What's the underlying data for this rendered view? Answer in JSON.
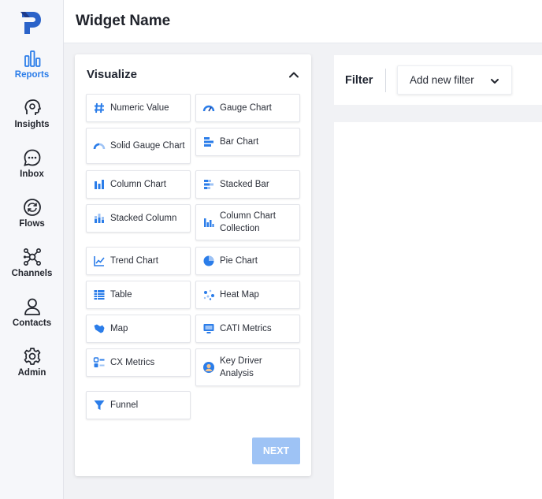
{
  "colors": {
    "accent": "#2b7de9",
    "next_disabled": "#9ec3f5",
    "icon_blue": "#2b7de9"
  },
  "sidebar": {
    "logo": "P",
    "items": [
      {
        "label": "Reports",
        "icon": "bar-chart-icon",
        "active": true
      },
      {
        "label": "Insights",
        "icon": "brain-icon",
        "active": false
      },
      {
        "label": "Inbox",
        "icon": "chat-bubble-icon",
        "active": false
      },
      {
        "label": "Flows",
        "icon": "flow-cycle-icon",
        "active": false
      },
      {
        "label": "Channels",
        "icon": "network-icon",
        "active": false
      },
      {
        "label": "Contacts",
        "icon": "person-icon",
        "active": false
      },
      {
        "label": "Admin",
        "icon": "gear-icon",
        "active": false
      }
    ]
  },
  "header": {
    "title": "Widget Name"
  },
  "visualize": {
    "title": "Visualize",
    "tiles": [
      {
        "label": "Numeric Value",
        "icon": "hash-icon"
      },
      {
        "label": "Gauge Chart",
        "icon": "gauge-icon"
      },
      {
        "label": "Solid Gauge Chart",
        "icon": "solid-gauge-icon"
      },
      {
        "label": "Bar Chart",
        "icon": "bar-chart-horizontal-icon"
      },
      {
        "label": "Column Chart",
        "icon": "column-chart-icon"
      },
      {
        "label": "Stacked Bar",
        "icon": "stacked-bar-icon"
      },
      {
        "label": "Stacked Column",
        "icon": "stacked-column-icon"
      },
      {
        "label": "Column Chart Collection",
        "icon": "column-collection-icon"
      },
      {
        "label": "Trend Chart",
        "icon": "trend-icon"
      },
      {
        "label": "Pie Chart",
        "icon": "pie-icon"
      },
      {
        "label": "Table",
        "icon": "table-icon"
      },
      {
        "label": "Heat Map",
        "icon": "heat-map-icon"
      },
      {
        "label": "Map",
        "icon": "map-icon"
      },
      {
        "label": "CATI Metrics",
        "icon": "monitor-icon"
      },
      {
        "label": "CX Metrics",
        "icon": "cx-metrics-icon"
      },
      {
        "label": "Key Driver Analysis",
        "icon": "key-driver-icon"
      },
      {
        "label": "Funnel",
        "icon": "funnel-icon"
      }
    ],
    "next_label": "NEXT"
  },
  "filter": {
    "label": "Filter",
    "add_label": "Add new filter"
  }
}
